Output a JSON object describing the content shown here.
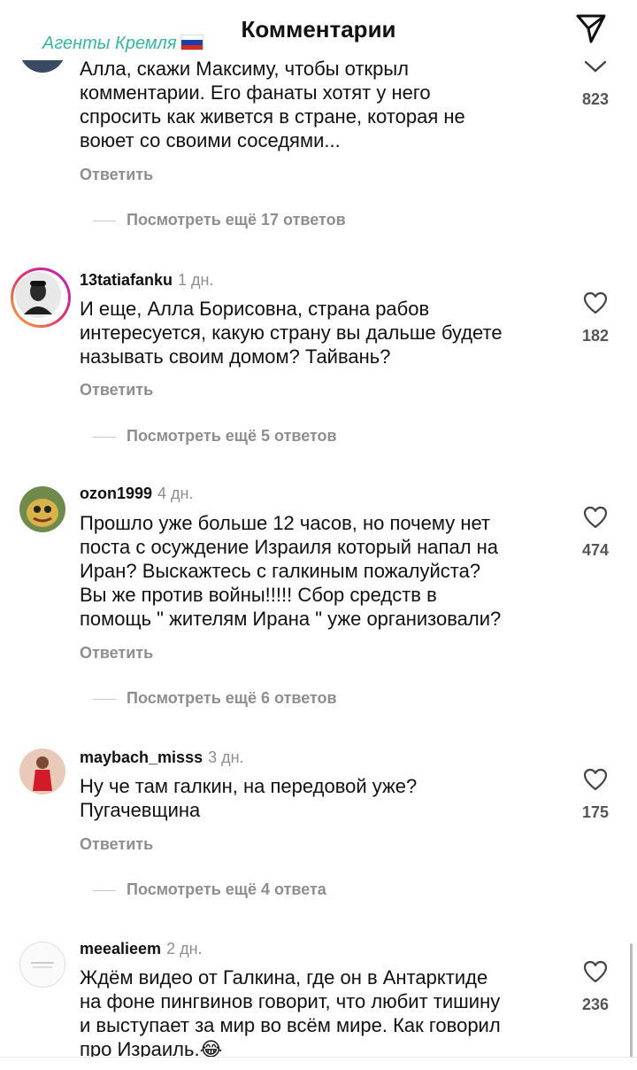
{
  "header": {
    "title": "Комментарии",
    "watermark": "Агенты Кремля"
  },
  "comments": [
    {
      "user": "",
      "time": "",
      "text": "Алла, скажи Максиму, чтобы открыл\nкомментарии. Его фанаты хотят у него\nспросить как живется в стране, которая не\nвоюет со своими соседями...",
      "reply": "Ответить",
      "more": "Посмотреть ещё 17 ответов",
      "likes": "823"
    },
    {
      "user": "13tatiafanku",
      "time": "1 дн.",
      "text": "И еще, Алла Борисовна, страна рабов\nинтересуется, какую страну вы дальше будете\nназывать своим домом? Тайвань?",
      "reply": "Ответить",
      "more": "Посмотреть ещё 5 ответов",
      "likes": "182"
    },
    {
      "user": "ozon1999",
      "time": "4 дн.",
      "text": "Прошло уже больше 12 часов, но почему нет\nпоста с осуждение Израиля который напал на\nИран? Выскажтесь с галкиным пожалуйста?\nВы же против войны!!!!! Сбор средств в\nпомощь \" жителям Ирана \" уже организовали?",
      "reply": "Ответить",
      "more": "Посмотреть ещё 6 ответов",
      "likes": "474"
    },
    {
      "user": "maybach_misss",
      "time": "3 дн.",
      "text": "Ну че там галкин, на передовой уже?\nПугачевщина",
      "reply": "Ответить",
      "more": "Посмотреть ещё 4 ответа",
      "likes": "175"
    },
    {
      "user": "meealieem",
      "time": "2 дн.",
      "text": "Ждём видео от Галкина, где он в Антарктиде\nна фоне пингвинов говорит, что любит тишину\nи выступает за мир во всём мире. Как говорил\nпро Израиль.😂",
      "reply": "",
      "more": "",
      "likes": "236"
    }
  ],
  "icons": {
    "share": "paper-plane-icon",
    "like": "heart-outline-icon"
  },
  "colors": {
    "watermark": "#34b6a6",
    "muted": "#8e8e8e"
  }
}
